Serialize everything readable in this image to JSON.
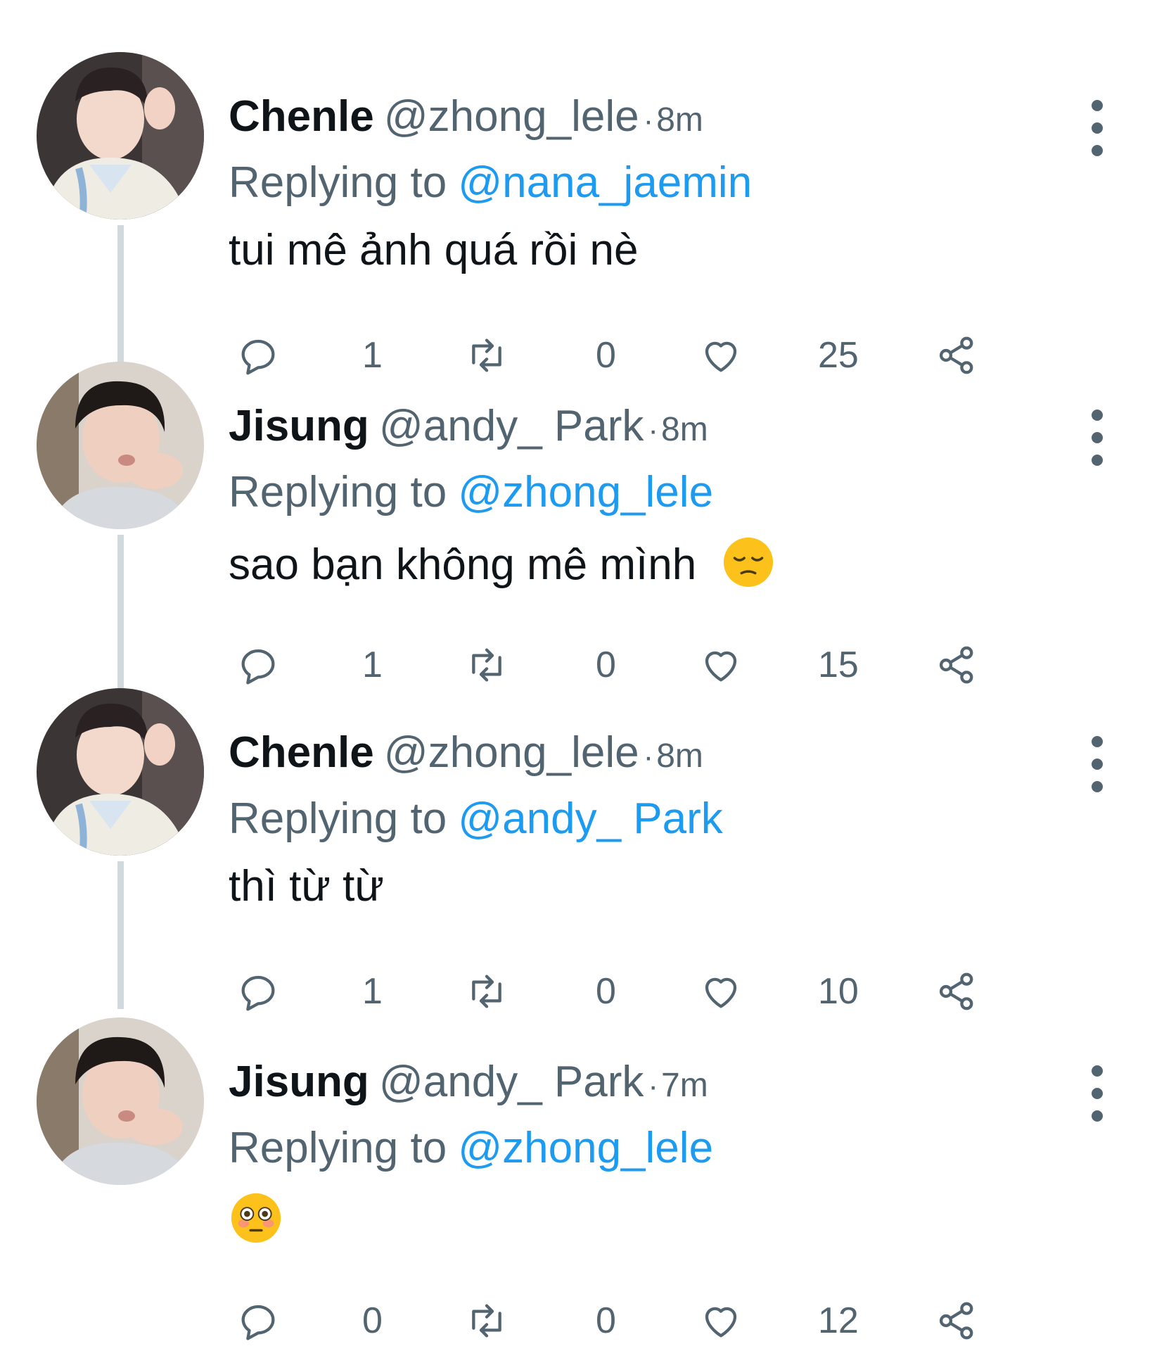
{
  "tweets": [
    {
      "name": "Chenle",
      "handle": "@zhong_lele",
      "separator": "·",
      "time": "8m",
      "replying_label": "Replying to",
      "replying_to": "@nana_jaemin",
      "text": "tui mê ảnh quá rồi nè",
      "emoji": "",
      "counts": {
        "replies": "1",
        "retweets": "0",
        "likes": "25"
      }
    },
    {
      "name": "Jisung",
      "handle": "@andy_ Park",
      "separator": "·",
      "time": "8m",
      "replying_label": "Replying to",
      "replying_to": "@zhong_lele",
      "text": "sao bạn không mê mình",
      "emoji": "pensive-face",
      "counts": {
        "replies": "1",
        "retweets": "0",
        "likes": "15"
      }
    },
    {
      "name": "Chenle",
      "handle": "@zhong_lele",
      "separator": "·",
      "time": "8m",
      "replying_label": "Replying to",
      "replying_to": "@andy_ Park",
      "text": "thì từ từ",
      "emoji": "",
      "counts": {
        "replies": "1",
        "retweets": "0",
        "likes": "10"
      }
    },
    {
      "name": "Jisung",
      "handle": "@andy_ Park",
      "separator": "·",
      "time": "7m",
      "replying_label": "Replying to",
      "replying_to": "@zhong_lele",
      "text": "",
      "emoji": "flushed-face",
      "counts": {
        "replies": "0",
        "retweets": "0",
        "likes": "12"
      }
    }
  ],
  "colors": {
    "primary_text": "#0f1419",
    "secondary_text": "#536471",
    "link": "#1d9bf0",
    "thread_line": "#cfd9de"
  }
}
